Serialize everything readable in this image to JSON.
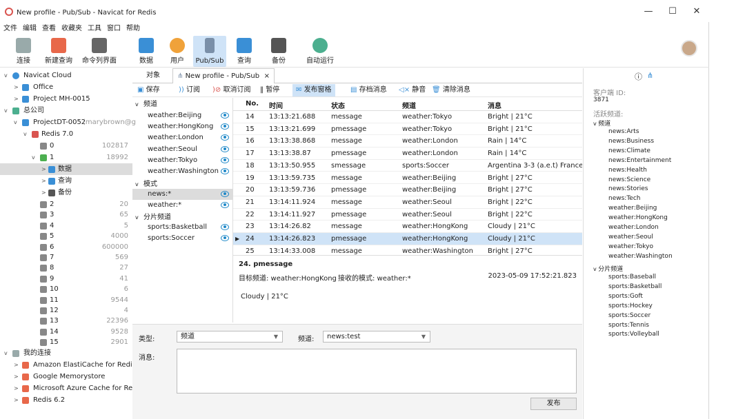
{
  "window": {
    "title": "New profile - Pub/Sub - Navicat for Redis",
    "min": "—",
    "max": "☐",
    "close": "✕"
  },
  "menu": [
    "文件",
    "编辑",
    "查看",
    "收藏夹",
    "工具",
    "窗口",
    "帮助"
  ],
  "toolbar": {
    "connect": "连接",
    "new_query": "新建查询",
    "cli": "命令列界面",
    "data": "数据",
    "user": "用户",
    "pubsub": "Pub/Sub",
    "query": "查询",
    "backup": "备份",
    "automation": "自动运行"
  },
  "tree": {
    "navicat_cloud": "Navicat Cloud",
    "office": "Office",
    "project_mh": "Project MH-0015",
    "company": "总公司",
    "project_dt": "ProjectDT-0052",
    "project_dt_owner": "(marybrown@g",
    "redis7": "Redis 7.0",
    "dbs": [
      {
        "n": "0",
        "c": "102817"
      },
      {
        "n": "1",
        "c": "18992"
      }
    ],
    "db1_children": {
      "data": "数据",
      "query": "查询",
      "backup": "备份"
    },
    "dbs2": [
      {
        "n": "2",
        "c": "20"
      },
      {
        "n": "3",
        "c": "65"
      },
      {
        "n": "4",
        "c": "5"
      },
      {
        "n": "5",
        "c": "4000"
      },
      {
        "n": "6",
        "c": "600000"
      },
      {
        "n": "7",
        "c": "569"
      },
      {
        "n": "8",
        "c": "27"
      },
      {
        "n": "9",
        "c": "41"
      },
      {
        "n": "10",
        "c": "6"
      },
      {
        "n": "11",
        "c": "9544"
      },
      {
        "n": "12",
        "c": "4"
      },
      {
        "n": "13",
        "c": "22396"
      },
      {
        "n": "14",
        "c": "9528"
      },
      {
        "n": "15",
        "c": "2901"
      }
    ],
    "my_conn": "我的连接",
    "conns": [
      "Amazon ElastiCache for Redis",
      "Google Memorystore",
      "Microsoft Azure Cache for Redis",
      "Redis 6.2"
    ]
  },
  "tabs": {
    "objects": "对象",
    "active": "New profile - Pub/Sub",
    "close": "×"
  },
  "subtoolbar": {
    "save": "保存",
    "subscribe": "订阅",
    "unsubscribe": "取消订阅",
    "pause": "暂停",
    "publish": "发布窗格",
    "archive": "存档消息",
    "mute": "静音",
    "clear": "清除消息"
  },
  "channels": {
    "ch_title": "频道",
    "ch_items": [
      "weather:Beijing",
      "weather:HongKong",
      "weather:London",
      "weather:Seoul",
      "weather:Tokyo",
      "weather:Washington"
    ],
    "pat_title": "模式",
    "pat_items": [
      "news:*",
      "weather:*"
    ],
    "shard_title": "分片频道",
    "shard_items": [
      "sports:Basketball",
      "sports:Soccer"
    ]
  },
  "grid": {
    "headers": [
      "No.",
      "时间",
      "状态",
      "频道",
      "消息"
    ],
    "rows": [
      [
        "14",
        "13:13:21.688",
        "message",
        "weather:Tokyo",
        "Bright | 21°C"
      ],
      [
        "15",
        "13:13:21.699",
        "pmessage",
        "weather:Tokyo",
        "Bright | 21°C"
      ],
      [
        "16",
        "13:13:38.868",
        "message",
        "weather:London",
        "Rain | 14°C"
      ],
      [
        "17",
        "13:13:38.87",
        "pmessage",
        "weather:London",
        "Rain | 14°C"
      ],
      [
        "18",
        "13:13:50.955",
        "smessage",
        "sports:Soccer",
        "Argentina 3-3 (a.e.t) France"
      ],
      [
        "19",
        "13:13:59.735",
        "message",
        "weather:Beijing",
        "Bright | 27°C"
      ],
      [
        "20",
        "13:13:59.736",
        "pmessage",
        "weather:Beijing",
        "Bright | 27°C"
      ],
      [
        "21",
        "13:14:11.924",
        "message",
        "weather:Seoul",
        "Bright | 22°C"
      ],
      [
        "22",
        "13:14:11.927",
        "pmessage",
        "weather:Seoul",
        "Bright | 22°C"
      ],
      [
        "23",
        "13:14:26.82",
        "message",
        "weather:HongKong",
        "Cloudy | 21°C"
      ],
      [
        "24",
        "13:14:26.823",
        "pmessage",
        "weather:HongKong",
        "Cloudy | 21°C"
      ],
      [
        "25",
        "13:14:33.008",
        "message",
        "weather:Washington",
        "Bright | 27°C"
      ]
    ]
  },
  "detail": {
    "title": "24. pmessage",
    "target": "目标频道: weather:HongKong",
    "pattern": "接收的模式: weather:*",
    "timestamp": "2023-05-09 17:52:21.823",
    "body": "Cloudy | 21°C"
  },
  "right": {
    "client_id_label": "客户端 ID:",
    "client_id": "3871",
    "active_label": "活跃频道:",
    "ch_title": "频道",
    "channels": [
      "news:Arts",
      "news:Business",
      "news:Climate",
      "news:Entertainment",
      "news:Health",
      "news:Science",
      "news:Stories",
      "news:Tech",
      "weather:Beijing",
      "weather:HongKong",
      "weather:London",
      "weather:Seoul",
      "weather:Tokyo",
      "weather:Washington"
    ],
    "shard_title": "分片频道",
    "shards": [
      "sports:Baseball",
      "sports:Basketball",
      "sports:Goft",
      "sports:Hockey",
      "sports:Soccer",
      "sports:Tennis",
      "sports:Volleyball"
    ]
  },
  "publish": {
    "type_label": "类型:",
    "type_value": "频道",
    "channel_label": "频道:",
    "channel_value": "news:test",
    "message_label": "消息:",
    "button": "发布"
  }
}
